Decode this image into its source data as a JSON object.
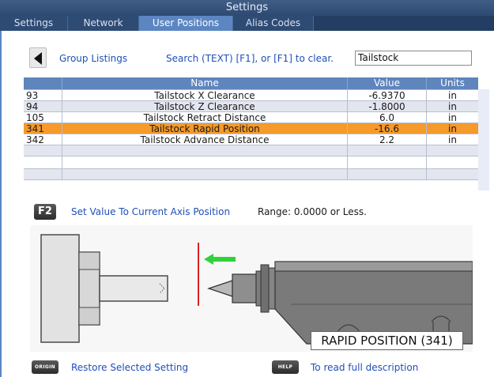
{
  "window": {
    "title": "Settings"
  },
  "tabs": [
    {
      "label": "Settings",
      "active": false
    },
    {
      "label": "Network",
      "active": false
    },
    {
      "label": "User Positions",
      "active": true
    },
    {
      "label": "Alias Codes",
      "active": false
    }
  ],
  "toolbar": {
    "group_listings": "Group Listings",
    "search_hint": "Search (TEXT) [F1], or [F1] to clear.",
    "search_value": "Tailstock"
  },
  "table": {
    "headers": {
      "number": "",
      "name": "Name",
      "value": "Value",
      "units": "Units"
    },
    "rows": [
      {
        "number": "93",
        "name": "Tailstock X Clearance",
        "value": "-6.9370",
        "units": "in",
        "selected": false
      },
      {
        "number": "94",
        "name": "Tailstock Z Clearance",
        "value": "-1.8000",
        "units": "in",
        "selected": false
      },
      {
        "number": "105",
        "name": "Tailstock Retract Distance",
        "value": "6.0",
        "units": "in",
        "selected": false
      },
      {
        "number": "341",
        "name": "Tailstock Rapid Position",
        "value": "-16.6",
        "units": "in",
        "selected": true
      },
      {
        "number": "342",
        "name": "Tailstock Advance Distance",
        "value": "2.2",
        "units": "in",
        "selected": false
      },
      {
        "number": "",
        "name": "",
        "value": "",
        "units": "",
        "selected": false
      },
      {
        "number": "",
        "name": "",
        "value": "",
        "units": "",
        "selected": false
      },
      {
        "number": "",
        "name": "",
        "value": "",
        "units": "",
        "selected": false
      }
    ]
  },
  "f2": {
    "key": "F2",
    "label": "Set Value To Current Axis Position",
    "range": "Range: 0.0000 or Less."
  },
  "diagram": {
    "caption": "RAPID POSITION (341)"
  },
  "footer": {
    "origin_key": "ORIGIN",
    "origin_label": "Restore Selected Setting",
    "help_key": "HELP",
    "help_label": "To read full description"
  },
  "colors": {
    "accent": "#5b86c2",
    "selected_row": "#f59a2b",
    "link": "#1f4fb8",
    "marker": "#e02020",
    "arrow": "#2fd23a"
  }
}
